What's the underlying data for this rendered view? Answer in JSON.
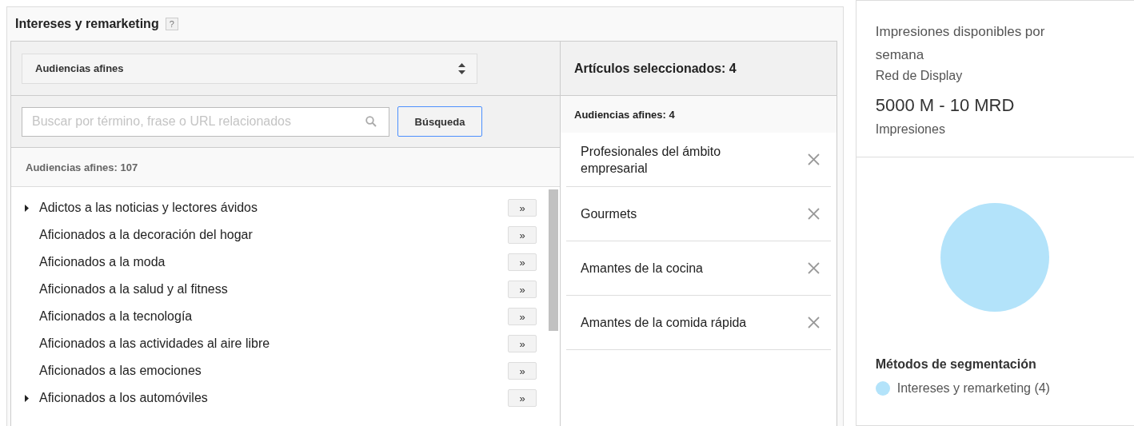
{
  "panel": {
    "title": "Intereses y remarketing",
    "help": "?"
  },
  "dropdown": {
    "value": "Audiencias afines"
  },
  "search": {
    "placeholder": "Buscar por término, frase o URL relacionados",
    "button": "Búsqueda"
  },
  "results": {
    "count_label": "Audiencias afines: 107",
    "add_label": "»",
    "items": [
      {
        "label": "Adictos a las noticias y lectores ávidos",
        "expandable": true
      },
      {
        "label": "Aficionados a la decoración del hogar",
        "expandable": false
      },
      {
        "label": "Aficionados a la moda",
        "expandable": false
      },
      {
        "label": "Aficionados a la salud y al fitness",
        "expandable": false
      },
      {
        "label": "Aficionados a la tecnología",
        "expandable": false
      },
      {
        "label": "Aficionados a las actividades al aire libre",
        "expandable": false
      },
      {
        "label": "Aficionados a las emociones",
        "expandable": false
      },
      {
        "label": "Aficionados a los automóviles",
        "expandable": true
      }
    ]
  },
  "selected": {
    "title": "Artículos seleccionados: 4",
    "group": "Audiencias afines: 4",
    "items": [
      "Profesionales del ámbito empresarial",
      "Gourmets",
      "Amantes de la cocina",
      "Amantes de la comida rápida"
    ]
  },
  "summary": {
    "title": "Impresiones disponibles por semana",
    "network": "Red de Display",
    "range": "5000 M - 10 MRD",
    "unit": "Impresiones",
    "legend_title": "Métodos de segmentación",
    "legend": [
      {
        "label": "Intereses y remarketing (4)",
        "color": "#b3e3fa"
      }
    ]
  }
}
